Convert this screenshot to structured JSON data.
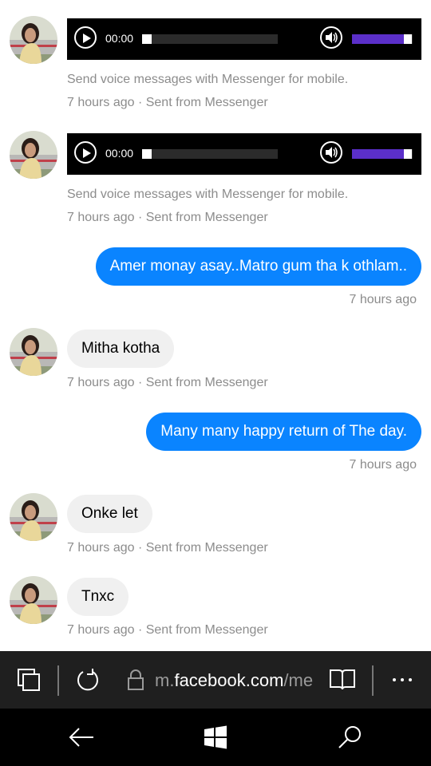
{
  "audio": {
    "time": "00:00",
    "volume_level": 0.85
  },
  "messages": {
    "voice_note": "Send voice messages with Messenger for mobile.",
    "meta_in": "7 hours ago · Sent from Messenger",
    "meta_out": "7 hours ago",
    "out1": "Amer monay asay..Matro gum tha k othlam..",
    "in1": "Mitha kotha",
    "out2": "Many many happy return of The day.",
    "in2": "Onke let",
    "in3": "Tnxc"
  },
  "browser": {
    "url_prefix": "m.",
    "url_main": "facebook.com",
    "url_suffix": "/me"
  },
  "icons": [
    "tabs-icon",
    "refresh-icon",
    "lock-icon",
    "reading-view-icon",
    "more-icon",
    "back-icon",
    "windows-icon",
    "search-icon"
  ],
  "colors": {
    "outgoing_bubble": "#0a84ff",
    "incoming_bubble": "#f0f0f0",
    "volume_fill": "#5b2fc9",
    "toolbar": "#1f1f1f"
  }
}
